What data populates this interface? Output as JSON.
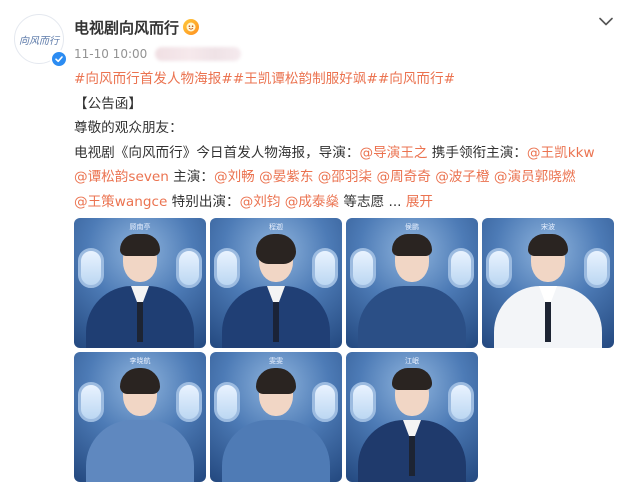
{
  "user": {
    "name": "电视剧向风而行",
    "avatar_text": "向风而行",
    "timestamp": "11-10 10:00"
  },
  "post": {
    "tags_line": [
      "#向风而行首发人物海报#",
      "#王凯谭松韵制服好飒#",
      "#向风而行#"
    ],
    "heading": "【公告函】",
    "greeting": "尊敬的观众朋友：",
    "line3_text1": "电视剧《向风而行》今日首发人物海报，导演：",
    "mention_director": "@导演王之",
    "line3_text2": " 携手领衔主演：",
    "mention_wangkai": "@王凯kkw",
    "mention_tan": "@谭松韵seven",
    "line4_text1": " 主演：",
    "cast_mentions": [
      "@刘畅",
      "@晏紫东",
      "@邵羽柒",
      "@周奇奇",
      "@波子橙",
      "@演员郭晓燃"
    ],
    "mention_wangce": "@王策wangce",
    "line5_text1": " 特别出演：",
    "special_mentions": [
      "@刘钧",
      "@成泰燊"
    ],
    "line5_text2": " 等志愿 ...",
    "expand_label": "展开"
  },
  "images": [
    {
      "label": "顾南亭"
    },
    {
      "label": "程迦"
    },
    {
      "label": "侯鹏"
    },
    {
      "label": "宋波"
    },
    {
      "label": "李晓航"
    },
    {
      "label": "雯雯"
    },
    {
      "label": "江岷"
    }
  ],
  "colors": {
    "link": "#eb7350",
    "verify": "#2c8cf2",
    "text": "#333333",
    "meta": "#939393"
  }
}
